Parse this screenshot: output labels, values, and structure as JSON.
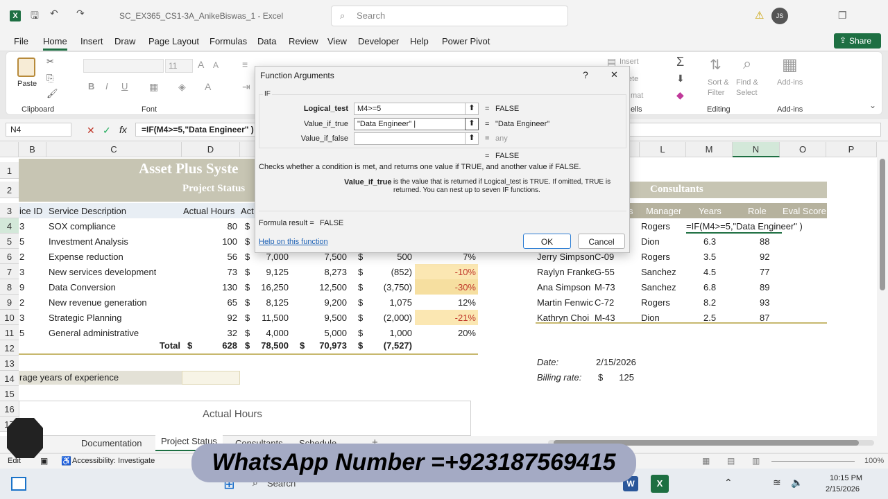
{
  "window": {
    "title": "SC_EX365_CS1-3A_AnikeBiswas_1  -  Excel",
    "search_placeholder": "Search",
    "user_initials": "JS"
  },
  "menu": [
    "File",
    "Home",
    "Insert",
    "Draw",
    "Page Layout",
    "Formulas",
    "Data",
    "Review",
    "View",
    "Developer",
    "Help",
    "Power Pivot"
  ],
  "share_label": "Share",
  "ribbon": {
    "paste": "Paste",
    "clipboard": "Clipboard",
    "font": "Font",
    "font_size": "11",
    "insert": "Insert",
    "delete": "ete",
    "format": "mat",
    "cells": "ells",
    "sort_filter": "Sort &",
    "filter": "Filter",
    "find_select": "Find &",
    "select": "Select",
    "editing": "Editing",
    "addins": "Add-ins",
    "addins_group": "Add-ins"
  },
  "formula_bar": {
    "name_box": "N4",
    "fx": "fx",
    "formula": "=IF(M4>=5,\"Data Engineer\" )"
  },
  "columns": [
    "B",
    "C",
    "D",
    "L",
    "M",
    "N",
    "O",
    "P"
  ],
  "rows": [
    "1",
    "2",
    "3",
    "4",
    "5",
    "6",
    "7",
    "8",
    "9",
    "10",
    "11",
    "12",
    "13",
    "14",
    "15",
    "16",
    "17"
  ],
  "sheet": {
    "title": "Asset Plus Syste",
    "subtitle": "Project Status",
    "h_id": "ice ID",
    "h_desc": "Service Description",
    "h_hours": "Actual Hours",
    "h_act": "Act",
    "data": [
      {
        "id": "3",
        "desc": "SOX compliance",
        "hours": "80",
        "cur": "$"
      },
      {
        "id": "5",
        "desc": "Investment Analysis",
        "hours": "100",
        "cur": "$"
      },
      {
        "id": "2",
        "desc": "Expense reduction",
        "hours": "56",
        "cur": "$",
        "e": "7,000",
        "f": "7,500",
        "g_cur": "$",
        "g": "500",
        "h": "7%"
      },
      {
        "id": "3",
        "desc": "New services development",
        "hours": "73",
        "cur": "$",
        "e": "9,125",
        "f": "8,273",
        "g_cur": "$",
        "g": "(852)",
        "h": "-10%"
      },
      {
        "id": "9",
        "desc": "Data Conversion",
        "hours": "130",
        "cur": "$",
        "e": "16,250",
        "f": "12,500",
        "g_cur": "$",
        "g": "(3,750)",
        "h": "-30%"
      },
      {
        "id": "2",
        "desc": "New revenue generation",
        "hours": "65",
        "cur": "$",
        "e": "8,125",
        "f": "9,200",
        "g_cur": "$",
        "g": "1,075",
        "h": "12%"
      },
      {
        "id": "3",
        "desc": "Strategic Planning",
        "hours": "92",
        "cur": "$",
        "e": "11,500",
        "f": "9,500",
        "g_cur": "$",
        "g": "(2,000)",
        "h": "-21%"
      },
      {
        "id": "5",
        "desc": "General administrative",
        "hours": "32",
        "cur": "$",
        "e": "4,000",
        "f": "5,000",
        "g_cur": "$",
        "g": "1,000",
        "h": "20%"
      }
    ],
    "total": {
      "label": "Total",
      "d_cur": "$",
      "d": "628",
      "e_cur": "$",
      "e": "78,500",
      "f_cur": "$",
      "f": "70,973",
      "g_cur": "$",
      "g": "(7,527)"
    },
    "avg_label": "rage years of experience",
    "chart_title": "Actual Hours",
    "consultants_title": "Consultants",
    "h_s": "s",
    "h_manager": "Manager",
    "h_years": "Years",
    "h_role": "Role",
    "h_eval": "Eval Score",
    "consultants": [
      {
        "name": "",
        "code": "",
        "manager": "Rogers",
        "years": "",
        "role": "",
        "eval": ""
      },
      {
        "name": "",
        "code": "",
        "manager": "Dion",
        "years": "6.3",
        "role": "",
        "eval": "88"
      },
      {
        "name": "Jerry Simpson",
        "code": "C-09",
        "manager": "Rogers",
        "years": "3.5",
        "role": "",
        "eval": "92"
      },
      {
        "name": "Raylyn Franke",
        "code": "G-55",
        "manager": "Sanchez",
        "years": "4.5",
        "role": "",
        "eval": "77"
      },
      {
        "name": "Ana Simpson",
        "code": "M-73",
        "manager": "Sanchez",
        "years": "6.8",
        "role": "",
        "eval": "89"
      },
      {
        "name": "Martin Fenwic",
        "code": "C-72",
        "manager": "Rogers",
        "years": "8.2",
        "role": "",
        "eval": "93"
      },
      {
        "name": "Kathryn Choi",
        "code": "M-43",
        "manager": "Dion",
        "years": "2.5",
        "role": "",
        "eval": "87"
      }
    ],
    "editing_cell": "=IF(M4>=5,\"Data Engineer\" )",
    "date_label": "Date:",
    "date_value": "2/15/2026",
    "billing_label": "Billing rate:",
    "billing_cur": "$",
    "billing_value": "125"
  },
  "dialog": {
    "title": "Function Arguments",
    "help_q": "?",
    "close": "✕",
    "func": "IF",
    "args": [
      {
        "label": "Logical_test",
        "value": "M4>=5",
        "result": "FALSE"
      },
      {
        "label": "Value_if_true",
        "value": "\"Data Engineer\" |",
        "result": "\"Data Engineer\""
      },
      {
        "label": "Value_if_false",
        "value": "",
        "result": "any"
      }
    ],
    "eq": "=",
    "overall": "FALSE",
    "description": "Checks whether a condition is met, and returns one value if TRUE, and another value if FALSE.",
    "arg_name": "Value_if_true",
    "arg_desc": "is the value that is returned if Logical_test is TRUE. If omitted, TRUE is returned. You can nest up to seven IF functions.",
    "formula_result_label": "Formula result =",
    "formula_result": "FALSE",
    "help_link": "Help on this function",
    "ok": "OK",
    "cancel": "Cancel"
  },
  "tabs": [
    "Documentation",
    "Project Status",
    "Consultants",
    "Schedule"
  ],
  "status": {
    "mode": "Edit",
    "accessibility": "Accessibility: Investigate",
    "zoom": "100%"
  },
  "taskbar": {
    "search": "Search",
    "time": "10:15 PM",
    "date": "2/15/2026"
  },
  "watermark": "WhatsApp Number =+923187569415"
}
